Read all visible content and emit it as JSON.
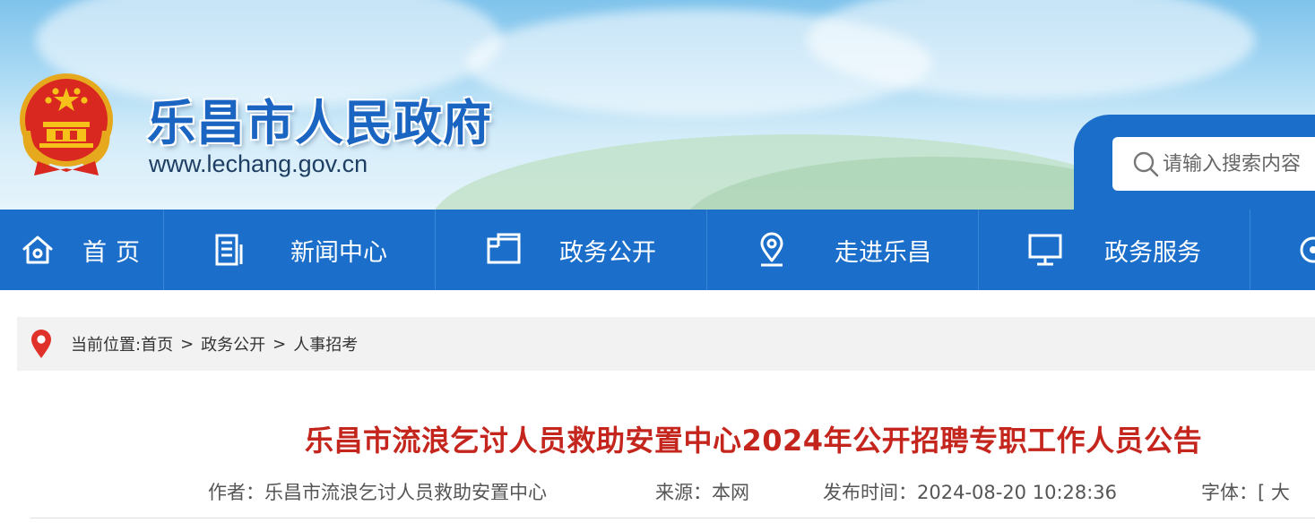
{
  "header": {
    "site_title": "乐昌市人民政府",
    "site_url": "www.lechang.gov.cn",
    "search": {
      "placeholder": "请输入搜索内容",
      "icon": "search-icon"
    },
    "emblem": "national-emblem"
  },
  "nav": {
    "items": [
      {
        "label": "首页",
        "icon": "home-icon"
      },
      {
        "label": "新闻中心",
        "icon": "news-document-icon"
      },
      {
        "label": "政务公开",
        "icon": "folder-icon"
      },
      {
        "label": "走进乐昌",
        "icon": "location-pin-icon"
      },
      {
        "label": "政务服务",
        "icon": "monitor-icon"
      }
    ],
    "partial_icon": "partially-visible-icon"
  },
  "breadcrumb": {
    "prefix": "当前位置:",
    "items": [
      "首页",
      "政务公开",
      "人事招考"
    ],
    "separator": ">",
    "icon": "map-pin-icon"
  },
  "article": {
    "title": "乐昌市流浪乞讨人员救助安置中心2024年公开招聘专职工作人员公告",
    "author_label": "作者：",
    "author": "乐昌市流浪乞讨人员救助安置中心",
    "source_label": "来源：",
    "source": "本网",
    "time_label": "发布时间：",
    "time": "2024-08-20 10:28:36",
    "font_label": "字体：",
    "font_bracket": "[",
    "font_large": "大"
  },
  "colors": {
    "nav_bg": "#1b6fca",
    "title_red": "#c4251d",
    "site_title_blue": "#1a64c2",
    "breadcrumb_bg": "#f2f2f2",
    "pin_red": "#e0322b"
  }
}
